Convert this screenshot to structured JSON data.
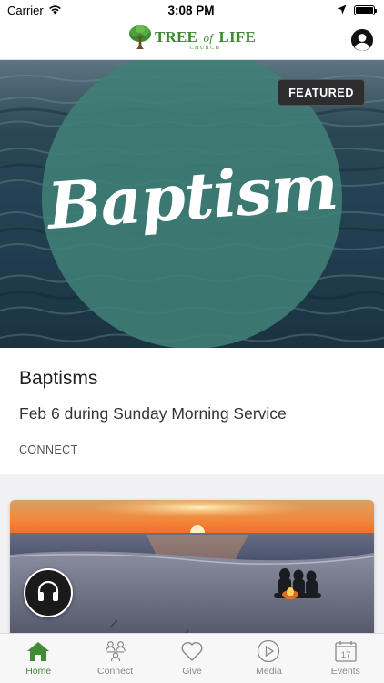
{
  "status_bar": {
    "carrier": "Carrier",
    "time": "3:08 PM"
  },
  "header": {
    "logo": {
      "name_part1": "TREE",
      "name_part2": "of",
      "name_part3": "LIFE",
      "subtitle": "CHURCH"
    },
    "brand_color": "#3d8a2e"
  },
  "featured": {
    "badge": "FEATURED",
    "image_text": "Baptism",
    "title": "Baptisms",
    "subtitle": "Feb 6 during Sunday Morning Service",
    "category": "CONNECT"
  },
  "tabs": [
    {
      "label": "Home",
      "icon": "home-icon",
      "active": true
    },
    {
      "label": "Connect",
      "icon": "people-icon",
      "active": false
    },
    {
      "label": "Give",
      "icon": "heart-icon",
      "active": false
    },
    {
      "label": "Media",
      "icon": "play-icon",
      "active": false
    },
    {
      "label": "Events",
      "icon": "calendar-icon",
      "active": false,
      "calendar_day": "17"
    }
  ],
  "colors": {
    "active_tab": "#3f8d33",
    "inactive_tab": "#8a8a8a",
    "badge_bg": "#2d2d30",
    "circle": "#408076"
  }
}
